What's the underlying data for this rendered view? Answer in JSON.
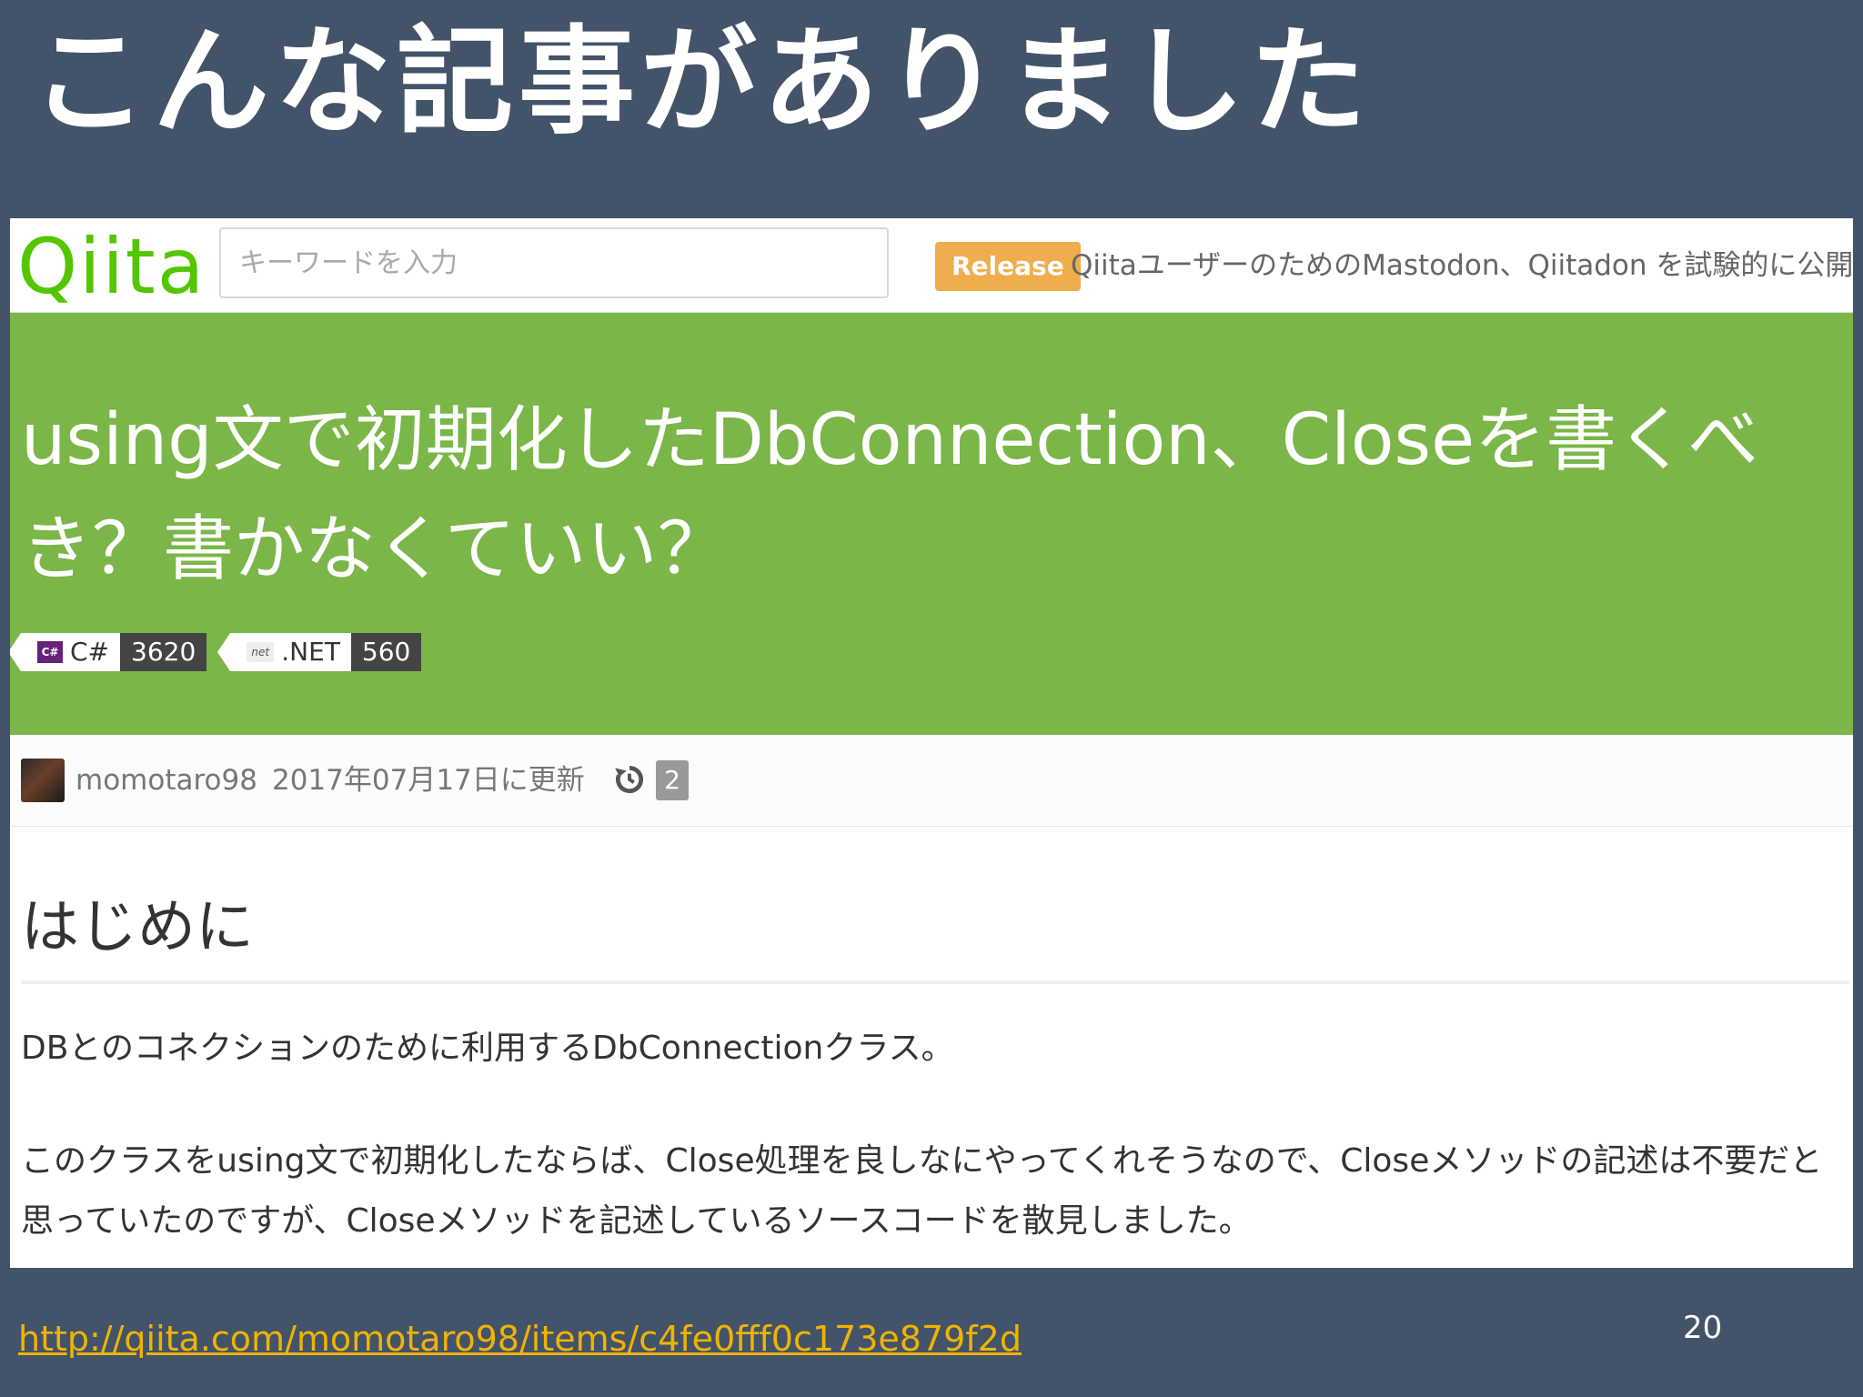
{
  "slide": {
    "title": "こんな記事がありました",
    "url": "http://qiita.com/momotaro98/items/c4fe0fff0c173e879f2d",
    "page_number": "20"
  },
  "qiita": {
    "logo": "Qiita",
    "search_placeholder": "キーワードを入力",
    "release_badge": "Release",
    "release_news": "QiitaユーザーのためのMastodon、Qiitadon を試験的に公開し",
    "article": {
      "title": "using文で初期化したDbConnection、Closeを書くべき？書かなくていい？",
      "tags": [
        {
          "icon": "csharp-icon",
          "icon_text": "C#",
          "name": "C#",
          "count": "3620"
        },
        {
          "icon": "dotnet-icon",
          "icon_text": "net",
          "name": ".NET",
          "count": "560"
        }
      ],
      "author": "momotaro98",
      "updated": "2017年07月17日に更新",
      "revisions": "2",
      "section_heading": "はじめに",
      "paragraph1": "DBとのコネクションのために利用するDbConnectionクラス。",
      "paragraph2": "このクラスをusing文で初期化したならば、Close処理を良しなにやってくれそうなので、Closeメソッドの記述は不要だと思っていたのですが、Closeメソッドを記述しているソースコードを散見しました。"
    }
  },
  "colors": {
    "slide_bg": "#43536a",
    "qiita_green": "#55c500",
    "banner_green": "#7ab648",
    "release_orange": "#f0ad4e",
    "link_yellow": "#f0b400"
  }
}
